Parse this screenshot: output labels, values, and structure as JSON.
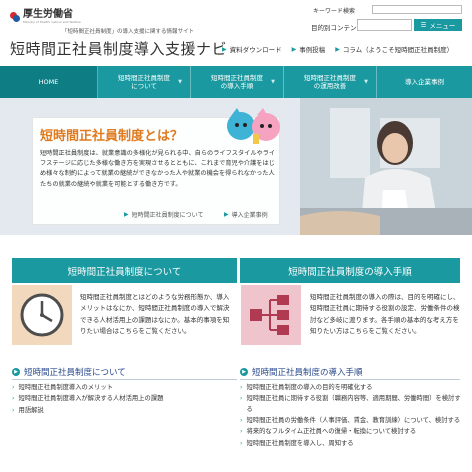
{
  "header": {
    "org_name": "厚生労働省",
    "org_sub": "Ministry of Health, Labour and Welfare",
    "tagline": "「短時間正社員制度」の導入支援に関する情報サイト",
    "site_title": "短時間正社員制度導入支援ナビ",
    "keyword_search_label": "キーワード検索",
    "content_search_label": "目的別コンテンツ検索",
    "menu_label": "メニュー",
    "sublinks": [
      "資料ダウンロード",
      "事例投稿",
      "コラム（ようこそ短時間正社員制度）"
    ]
  },
  "nav": {
    "items": [
      {
        "label": "HOME"
      },
      {
        "label": "短時間正社員制度\nについて"
      },
      {
        "label": "短時間正社員制度\nの導入手順"
      },
      {
        "label": "短時間正社員制度\nの運用改善"
      },
      {
        "label": "導入企業事例"
      }
    ]
  },
  "hero": {
    "title": "短時間正社員制度とは？",
    "body": "短時間正社員制度は、就業意識の多様化が見られる中、自らのライフスタイルやライフステージに応じた多様な働き方を実現させるとともに、これまで育児や介護をはじめ様々な制約によって就業の継続ができなかった人や就業の機会を得られなかった人たちの就業の継続や就業を可能とする働き方です。",
    "link_about": "短時間正社員制度について",
    "link_cases": "導入企業事例"
  },
  "left_section": {
    "heading": "短時間正社員制度について",
    "text": "短時間正社員制度とはどのような労務形態か、導入メリットはなにか、短時間正社員制度の導入で解決できる人材活用上の課題はなにか。基本的事項を知りたい場合はこちらをご覧ください。",
    "subheading": "短時間正社員制度について",
    "links": [
      "短時間正社員制度導入のメリット",
      "短時間正社員制度導入が解決する人材活用上の課題",
      "用語解説"
    ]
  },
  "right_section": {
    "heading": "短時間正社員制度の導入手順",
    "text": "短時間正社員制度の導入の際は、目的を明確にし、短時間正社員に期待する役割の設定、労働条件の検討など多岐に渡ります。各手順の基本的な考え方を知りたい方はこちらをご覧ください。",
    "subheading": "短時間正社員制度の導入手順",
    "links": [
      "短時間正社員制度の導入の目的を明確化する",
      "短時間正社員に期待する役割（職務内容等、適用期間、労働時間）を検討する",
      "短時間正社員の労働条件（人事評価、賃金、教育訓練）について、検討する",
      "将来的なフルタイム正社員への復帰・転換について検討する",
      "短時間正社員制度を導入し、周知する"
    ]
  },
  "colors": {
    "teal": "#1a9aa0",
    "teal_dark": "#0f7e84",
    "orange_title": "#e07a1f",
    "link_blue": "#2a4b8d"
  }
}
